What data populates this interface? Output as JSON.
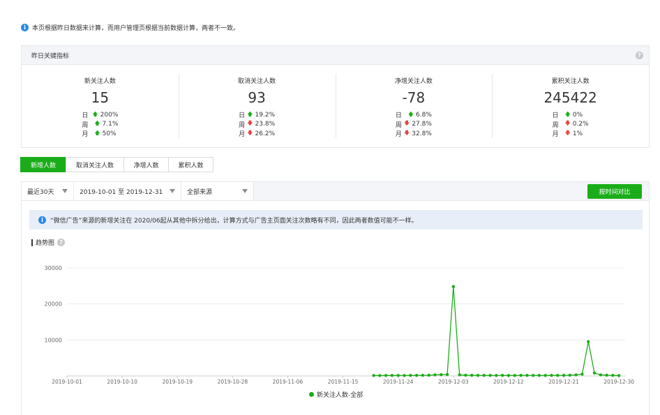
{
  "notice_top": "本页根据昨日数据来计算，而用户管理页根据当前数据计算，两者不一致。",
  "kpi": {
    "title": "昨日关键指标",
    "items": [
      {
        "label": "新关注人数",
        "value": "15",
        "rows": [
          {
            "period": "日",
            "dir": "up",
            "pct": "200%"
          },
          {
            "period": "周",
            "dir": "up",
            "pct": "7.1%"
          },
          {
            "period": "月",
            "dir": "up",
            "pct": "50%"
          }
        ]
      },
      {
        "label": "取消关注人数",
        "value": "93",
        "rows": [
          {
            "period": "日",
            "dir": "up",
            "pct": "19.2%"
          },
          {
            "period": "周",
            "dir": "down",
            "pct": "23.8%"
          },
          {
            "period": "月",
            "dir": "down",
            "pct": "26.2%"
          }
        ]
      },
      {
        "label": "净增关注人数",
        "value": "-78",
        "rows": [
          {
            "period": "日",
            "dir": "up",
            "pct": "6.8%"
          },
          {
            "period": "周",
            "dir": "down",
            "pct": "27.8%"
          },
          {
            "period": "月",
            "dir": "down",
            "pct": "32.8%"
          }
        ]
      },
      {
        "label": "累积关注人数",
        "value": "245422",
        "rows": [
          {
            "period": "日",
            "dir": "up",
            "pct": "0%"
          },
          {
            "period": "周",
            "dir": "down",
            "pct": "0.2%"
          },
          {
            "period": "月",
            "dir": "down",
            "pct": "1%"
          }
        ]
      }
    ]
  },
  "tabs": [
    "新增人数",
    "取消关注人数",
    "净增人数",
    "累积人数"
  ],
  "filters": {
    "range": "最近30天",
    "dates": "2019-10-01 至 2019-12-31",
    "source": "全部来源",
    "compare_button": "按时间对比"
  },
  "notice_ad": "“微信广告”来源的新增关注在 2020/06起从其他中拆分给出，计算方式与广告主页面关注次数略有不同，因此两者数值可能不一样。",
  "trend_title": "趋势图",
  "colors": {
    "accent": "#1aad19",
    "up": "#1aad19",
    "down": "#e64340"
  },
  "chart_data": {
    "type": "line",
    "title": "",
    "xlabel": "",
    "ylabel": "",
    "ylim": [
      0,
      30000
    ],
    "yticks": [
      10000,
      20000,
      30000
    ],
    "xtick_labels": [
      "2019-10-01",
      "2019-10-10",
      "2019-10-19",
      "2019-10-28",
      "2019-11-06",
      "2019-11-15",
      "2019-11-24",
      "2019-12-03",
      "2019-12-12",
      "2019-12-21",
      "2019-12-30"
    ],
    "xlim": [
      "2019-10-01",
      "2019-12-31"
    ],
    "grid": true,
    "legend": "bottom",
    "series": [
      {
        "name": "新关注人数-全部",
        "x": [
          "2019-11-20",
          "2019-11-21",
          "2019-11-22",
          "2019-11-23",
          "2019-11-24",
          "2019-11-25",
          "2019-11-26",
          "2019-11-27",
          "2019-11-28",
          "2019-11-29",
          "2019-11-30",
          "2019-12-01",
          "2019-12-02",
          "2019-12-03",
          "2019-12-04",
          "2019-12-05",
          "2019-12-06",
          "2019-12-07",
          "2019-12-08",
          "2019-12-09",
          "2019-12-10",
          "2019-12-11",
          "2019-12-12",
          "2019-12-13",
          "2019-12-14",
          "2019-12-15",
          "2019-12-16",
          "2019-12-17",
          "2019-12-18",
          "2019-12-19",
          "2019-12-20",
          "2019-12-21",
          "2019-12-22",
          "2019-12-23",
          "2019-12-24",
          "2019-12-25",
          "2019-12-26",
          "2019-12-27",
          "2019-12-28",
          "2019-12-29",
          "2019-12-30"
        ],
        "y": [
          120,
          110,
          130,
          125,
          140,
          120,
          150,
          160,
          170,
          200,
          300,
          350,
          400,
          24800,
          300,
          200,
          180,
          150,
          160,
          150,
          140,
          150,
          130,
          140,
          160,
          150,
          140,
          150,
          130,
          160,
          150,
          170,
          200,
          300,
          500,
          9500,
          800,
          300,
          200,
          150,
          100
        ]
      }
    ]
  }
}
